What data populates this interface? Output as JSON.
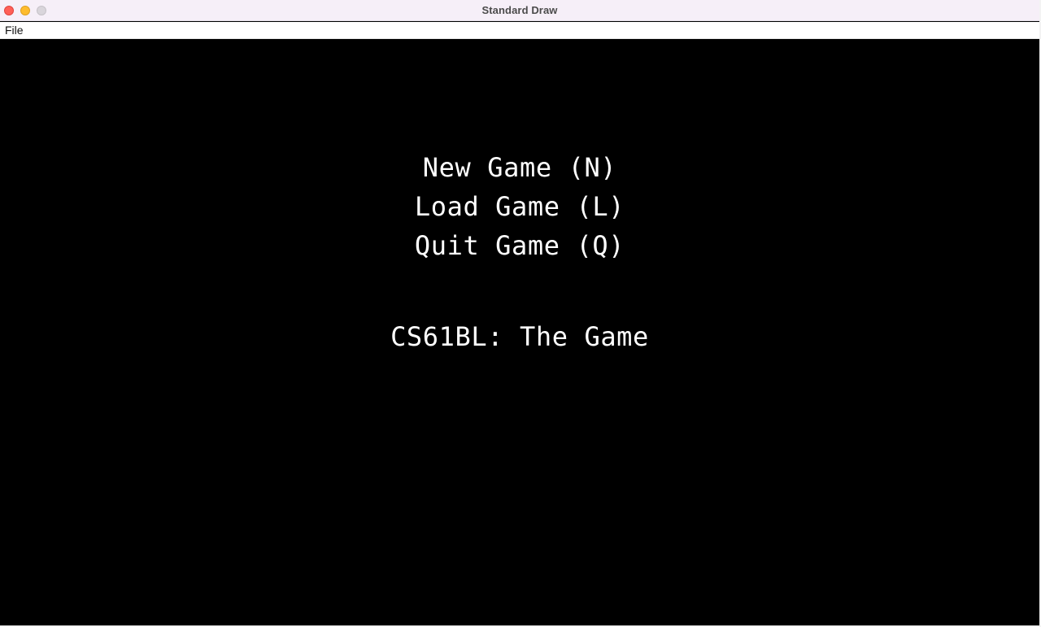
{
  "window": {
    "title": "Standard Draw",
    "controls": {
      "close": "close-icon",
      "minimize": "minimize-icon",
      "zoom": "zoom-icon"
    }
  },
  "menu_bar": {
    "items": [
      {
        "label": "File"
      }
    ]
  },
  "game_menu": {
    "options": [
      {
        "label": "New Game (N)"
      },
      {
        "label": "Load Game (L)"
      },
      {
        "label": "Quit Game (Q)"
      }
    ],
    "title": "CS61BL: The Game"
  },
  "colors": {
    "canvas": "#000000",
    "text": "#ffffff",
    "titlebar": "#f6eff8",
    "close": "#ff5f57",
    "minimize": "#febc2e",
    "zoom": "#d9d5db"
  }
}
